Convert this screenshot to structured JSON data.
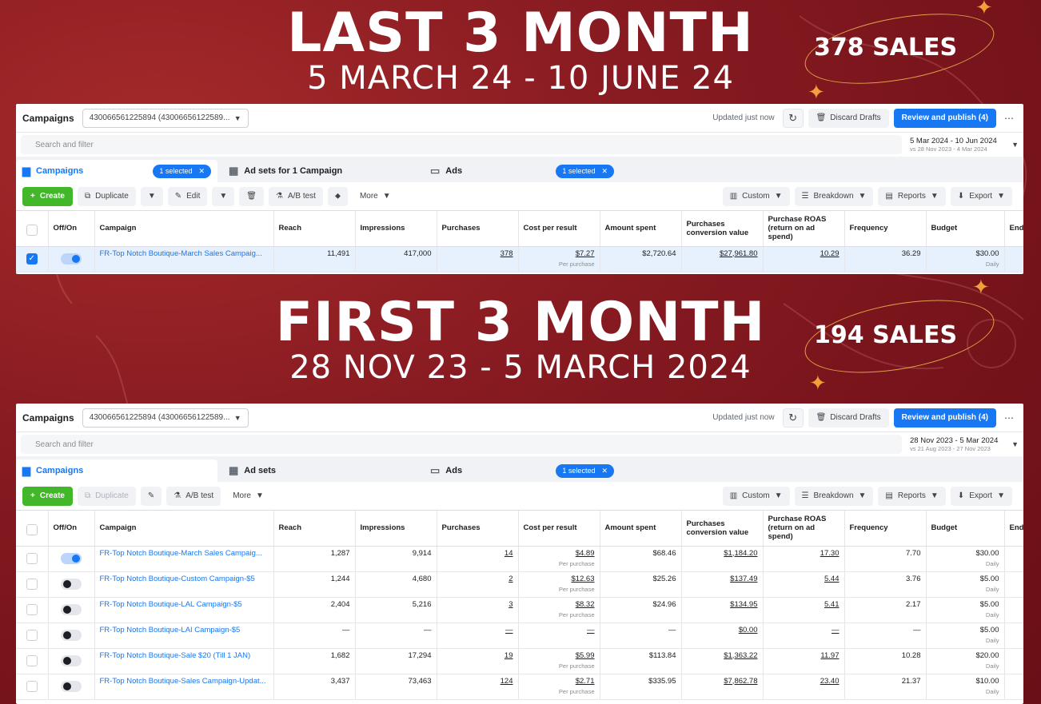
{
  "sections": [
    {
      "heading": "LAST 3 MONTH",
      "dates": "5 MARCH 24 - 10 JUNE 24",
      "sales": "378 SALES",
      "panel": {
        "title": "Campaigns",
        "account": "430066561225894 (43006656122589...",
        "updated": "Updated just now",
        "discard": "Discard Drafts",
        "publish": "Review and publish (4)",
        "search_placeholder": "Search and filter",
        "date_main": "5 Mar 2024 - 10 Jun 2024",
        "date_compare": "vs 28 Nov 2023 - 4 Mar 2024",
        "tabs": [
          {
            "label": "Campaigns",
            "chip": "1 selected"
          },
          {
            "label": "Ad sets for 1 Campaign",
            "chip": ""
          },
          {
            "label": "Ads",
            "chip": "1 selected"
          }
        ],
        "tools": {
          "create": "Create",
          "duplicate": "Duplicate",
          "edit": "Edit",
          "ab": "A/B test",
          "more": "More"
        },
        "columns_right": {
          "custom": "Custom",
          "breakdown": "Breakdown",
          "reports": "Reports",
          "export": "Export"
        },
        "rows": [
          {
            "name": "FR-Top Notch Boutique-March Sales Campaig...",
            "reach": "11,491",
            "impressions": "417,000",
            "purchases": "378",
            "cost": "$7.27",
            "cost_sub": "Per purchase",
            "spent": "$2,720.64",
            "conv_value": "$27,961.80",
            "roas": "10.29",
            "frequency": "36.29",
            "budget": "$30.00",
            "budget_sub": "Daily",
            "on": true,
            "selected": true
          }
        ]
      }
    },
    {
      "heading": "FIRST 3 MONTH",
      "dates": "28 NOV 23 - 5 MARCH 2024",
      "sales": "194 SALES",
      "panel": {
        "title": "Campaigns",
        "account": "430066561225894 (43006656122589...",
        "updated": "Updated just now",
        "discard": "Discard Drafts",
        "publish": "Review and publish (4)",
        "search_placeholder": "Search and filter",
        "date_main": "28 Nov 2023 - 5 Mar 2024",
        "date_compare": "vs 21 Aug 2023 - 27 Nov 2023",
        "tabs": [
          {
            "label": "Campaigns",
            "chip": ""
          },
          {
            "label": "Ad sets",
            "chip": ""
          },
          {
            "label": "Ads",
            "chip": "1 selected"
          }
        ],
        "tools": {
          "create": "Create",
          "duplicate": "Duplicate",
          "edit": "",
          "ab": "A/B test",
          "more": "More"
        },
        "columns_right": {
          "custom": "Custom",
          "breakdown": "Breakdown",
          "reports": "Reports",
          "export": "Export"
        },
        "rows": [
          {
            "name": "FR-Top Notch Boutique-March Sales Campaig...",
            "reach": "1,287",
            "impressions": "9,914",
            "purchases": "14",
            "cost": "$4.89",
            "cost_sub": "Per purchase",
            "spent": "$68.46",
            "conv_value": "$1,184.20",
            "roas": "17.30",
            "frequency": "7.70",
            "budget": "$30.00",
            "budget_sub": "Daily",
            "on": true,
            "selected": false
          },
          {
            "name": "FR-Top Notch Boutique-Custom Campaign-$5",
            "reach": "1,244",
            "impressions": "4,680",
            "purchases": "2",
            "cost": "$12.63",
            "cost_sub": "Per purchase",
            "spent": "$25.26",
            "conv_value": "$137.49",
            "roas": "5.44",
            "frequency": "3.76",
            "budget": "$5.00",
            "budget_sub": "Daily",
            "on": false,
            "selected": false
          },
          {
            "name": "FR-Top Notch Boutique-LAL Campaign-$5",
            "reach": "2,404",
            "impressions": "5,216",
            "purchases": "3",
            "cost": "$8.32",
            "cost_sub": "Per purchase",
            "spent": "$24.96",
            "conv_value": "$134.95",
            "roas": "5.41",
            "frequency": "2.17",
            "budget": "$5.00",
            "budget_sub": "Daily",
            "on": false,
            "selected": false
          },
          {
            "name": "FR-Top Notch Boutique-LAI Campaign-$5",
            "reach": "—",
            "impressions": "—",
            "purchases": "—",
            "cost": "—",
            "cost_sub": "",
            "spent": "—",
            "conv_value": "$0.00",
            "roas": "—",
            "frequency": "—",
            "budget": "$5.00",
            "budget_sub": "Daily",
            "on": false,
            "selected": false
          },
          {
            "name": "FR-Top Notch Boutique-Sale $20 (Till 1 JAN)",
            "reach": "1,682",
            "impressions": "17,294",
            "purchases": "19",
            "cost": "$5.99",
            "cost_sub": "Per purchase",
            "spent": "$113.84",
            "conv_value": "$1,363.22",
            "roas": "11.97",
            "frequency": "10.28",
            "budget": "$20.00",
            "budget_sub": "Daily",
            "on": false,
            "selected": false
          },
          {
            "name": "FR-Top Notch Boutique-Sales Campaign-Updat...",
            "reach": "3,437",
            "impressions": "73,463",
            "purchases": "124",
            "cost": "$2.71",
            "cost_sub": "Per purchase",
            "spent": "$335.95",
            "conv_value": "$7,862.78",
            "roas": "23.40",
            "frequency": "21.37",
            "budget": "$10.00",
            "budget_sub": "Daily",
            "on": false,
            "selected": false
          }
        ]
      }
    }
  ],
  "columns": [
    "Off/On",
    "Campaign",
    "Reach",
    "Impressions",
    "Purchases",
    "Cost per result",
    "Amount spent",
    "Purchases conversion value",
    "Purchase ROAS (return on ad spend)",
    "Frequency",
    "Budget",
    "Ends"
  ],
  "colors": {
    "accent": "#1877f2",
    "create": "#42b72a",
    "background": "#7a141c",
    "spark": "#f2a03a"
  }
}
